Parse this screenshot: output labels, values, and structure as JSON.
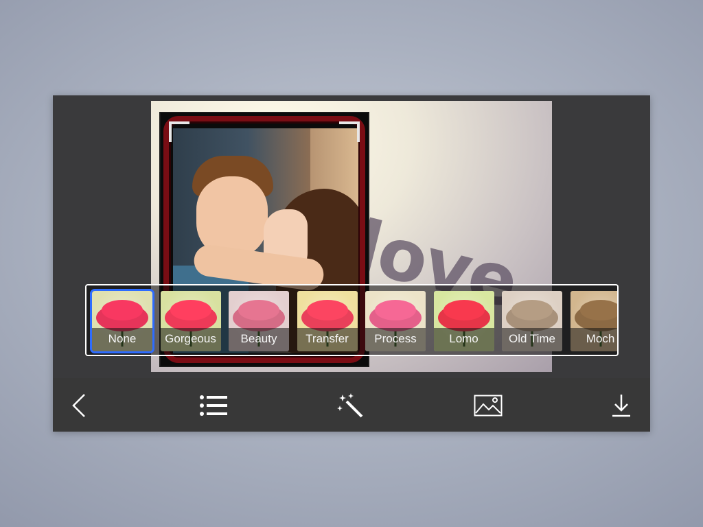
{
  "filters": [
    {
      "label": "None",
      "selected": true,
      "bg": "#dfe0b0",
      "petal": "#e6345a"
    },
    {
      "label": "Gorgeous",
      "selected": false,
      "bg": "#d8e1a0",
      "petal": "#ee3a58"
    },
    {
      "label": "Beauty",
      "selected": false,
      "bg": "#e3cfcf",
      "petal": "#d56c86"
    },
    {
      "label": "Transfer",
      "selected": false,
      "bg": "#efe09e",
      "petal": "#e9405a"
    },
    {
      "label": "Process",
      "selected": false,
      "bg": "#ece3c8",
      "petal": "#e4608a"
    },
    {
      "label": "Lomo",
      "selected": false,
      "bg": "#d8e7a0",
      "petal": "#e63548"
    },
    {
      "label": "Old Time",
      "selected": false,
      "bg": "#ddd0c4",
      "petal": "#a8917a"
    },
    {
      "label": "Moch",
      "selected": false,
      "bg": "#d2b68e",
      "petal": "#8c6a44"
    }
  ],
  "toolbar": {
    "back": "chevron-left-icon",
    "list": "list-icon",
    "effects": "magic-wand-icon",
    "background": "image-icon",
    "save": "download-icon"
  },
  "colors": {
    "selection": "#2e6cff",
    "toolbar_bg": "#383838",
    "frame_red": "#7a0d14"
  }
}
